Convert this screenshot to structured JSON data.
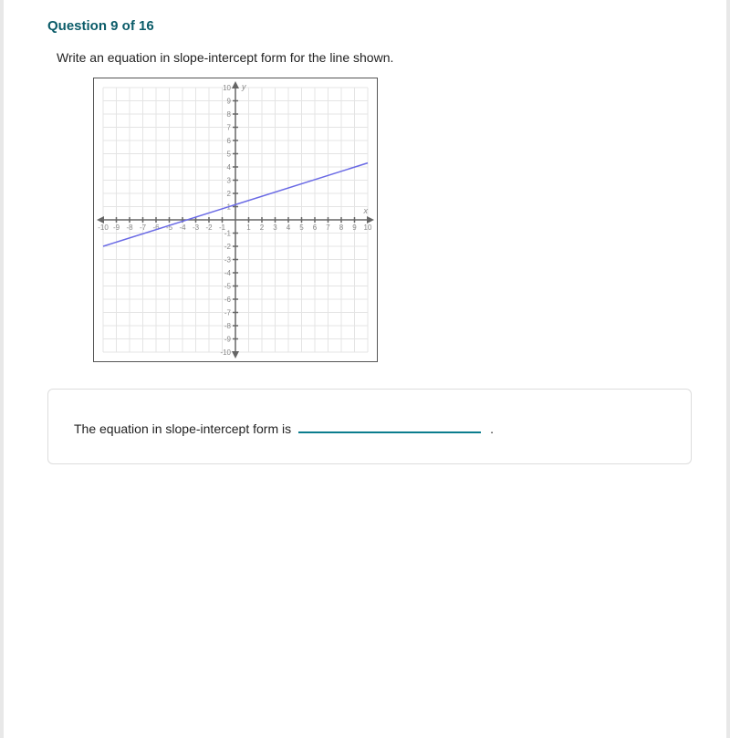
{
  "header": {
    "title": "Question 9 of 16"
  },
  "question": {
    "prompt": "Write an equation in slope-intercept form for the line shown."
  },
  "chart_data": {
    "type": "line",
    "xlabel": "x",
    "ylabel": "y",
    "xlim": [
      -10,
      10
    ],
    "ylim": [
      -10,
      10
    ],
    "grid": true,
    "x_ticks": [
      -10,
      -9,
      -8,
      -7,
      -6,
      -5,
      -4,
      -3,
      -2,
      -1,
      1,
      2,
      3,
      4,
      5,
      6,
      7,
      8,
      9,
      10
    ],
    "y_ticks": [
      -10,
      -9,
      -8,
      -7,
      -6,
      -5,
      -4,
      -3,
      -2,
      -1,
      1,
      2,
      3,
      4,
      5,
      6,
      7,
      8,
      9,
      10
    ],
    "series": [
      {
        "name": "line",
        "points": [
          {
            "x": -10,
            "y": -2
          },
          {
            "x": 10,
            "y": 4.3
          }
        ],
        "color": "#6a6ae5"
      }
    ],
    "note": "line passes approximately through (-3,0) and (0,1); slope ≈ 1/3, y-intercept ≈ 1"
  },
  "answer": {
    "label": "The equation in slope-intercept form is",
    "blank_value": "",
    "trailing": "."
  }
}
